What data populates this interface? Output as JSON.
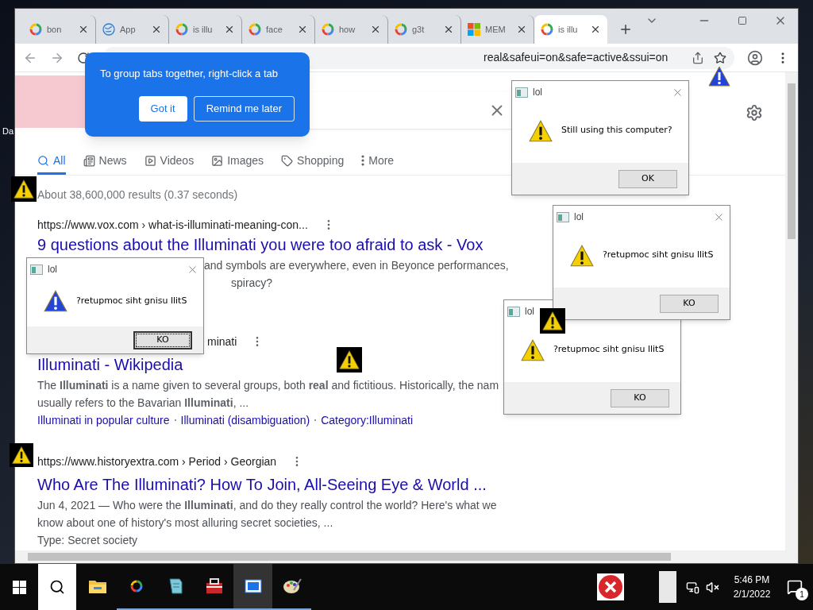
{
  "desktop": {
    "icon_label": "Da"
  },
  "browser": {
    "tabs": [
      {
        "title": "bon",
        "kind": "ring",
        "selected": false
      },
      {
        "title": "App",
        "kind": "globe",
        "selected": false
      },
      {
        "title": "is illu",
        "kind": "ring",
        "selected": false
      },
      {
        "title": "face",
        "kind": "ring",
        "selected": false
      },
      {
        "title": "how",
        "kind": "ring",
        "selected": false
      },
      {
        "title": "g3t",
        "kind": "ring",
        "selected": false
      },
      {
        "title": "MEM",
        "kind": "squares",
        "selected": false
      },
      {
        "title": "is illu",
        "kind": "ring",
        "selected": true
      }
    ],
    "address": "real&safeui=on&safe=active&ssui=on"
  },
  "tab_tip": {
    "text": "To group tabs together, right-click a tab",
    "buttons": [
      {
        "label": "Got it",
        "kind": "secondary"
      },
      {
        "label": "Remind me later",
        "kind": "primary"
      }
    ]
  },
  "search": {
    "nav": [
      {
        "label": "All",
        "kind": "search",
        "selected": true
      },
      {
        "label": "News",
        "kind": "news",
        "selected": false
      },
      {
        "label": "Videos",
        "kind": "video",
        "selected": false
      },
      {
        "label": "Images",
        "kind": "image",
        "selected": false
      },
      {
        "label": "Shopping",
        "kind": "tag",
        "selected": false
      },
      {
        "label": "More",
        "kind": "dots",
        "selected": false
      }
    ],
    "stats": "About 38,600,000 results (0.37 seconds)",
    "results": [
      {
        "breadcrumb": "https://www.vox.com › what-is-illuminati-meaning-con...",
        "title": "9 questions about the Illuminati you were too afraid to ask - Vox",
        "snippet": [
          "and symbols are everywhere, even in Beyonce performances,",
          "spiracy?"
        ]
      },
      {
        "breadcrumb": "minati",
        "title": "Illuminati - Wikipedia",
        "snippet": [
          "The **Illuminati** is a name given to several groups, both **real** and fictitious. Historically, the nam",
          "usually refers to the Bavarian **Illuminati**, ..."
        ],
        "links": [
          "Illuminati in popular culture",
          "Illuminati (disambiguation)",
          "Category:Illuminati"
        ]
      },
      {
        "breadcrumb": "https://www.historyextra.com › Period › Georgian",
        "title": "Who Are The Illuminati? How To Join, All-Seeing Eye & World ...",
        "snippet": [
          "Jun 4, 2021 — Who were the **Illuminati**, and do they really control the world? Here's what we",
          "know about one of history's most alluring secret societies, ..."
        ],
        "meta": "Type: Secret society"
      }
    ]
  },
  "dialogs": [
    {
      "title": "lol",
      "message": "Still using this computer?",
      "button": "OK",
      "kind": "warning",
      "focused": false
    },
    {
      "title": "lol",
      "message": "?retupmoc siht gnisu llitS",
      "button": "KO",
      "kind": "warning",
      "focused": false
    },
    {
      "title": "lol",
      "message": "?retupmoc siht gnisu llitS",
      "button": "KO",
      "kind": "warning",
      "focused": false
    },
    {
      "title": "lol",
      "message": "?retupmoc siht gnisu llitS",
      "button": "KO",
      "kind": "alert",
      "focused": true
    }
  ],
  "taskbar": {
    "apps": [
      {
        "kind": "folder",
        "running": false,
        "active": false
      },
      {
        "kind": "browser",
        "running": true,
        "active": false
      },
      {
        "kind": "notepad",
        "running": true,
        "active": false
      },
      {
        "kind": "toolbox",
        "running": true,
        "active": false
      },
      {
        "kind": "window",
        "running": true,
        "active": true
      },
      {
        "kind": "paint",
        "running": true,
        "active": false
      }
    ],
    "time": "5:46 PM",
    "date": "2/1/2022",
    "notifications": "1"
  }
}
